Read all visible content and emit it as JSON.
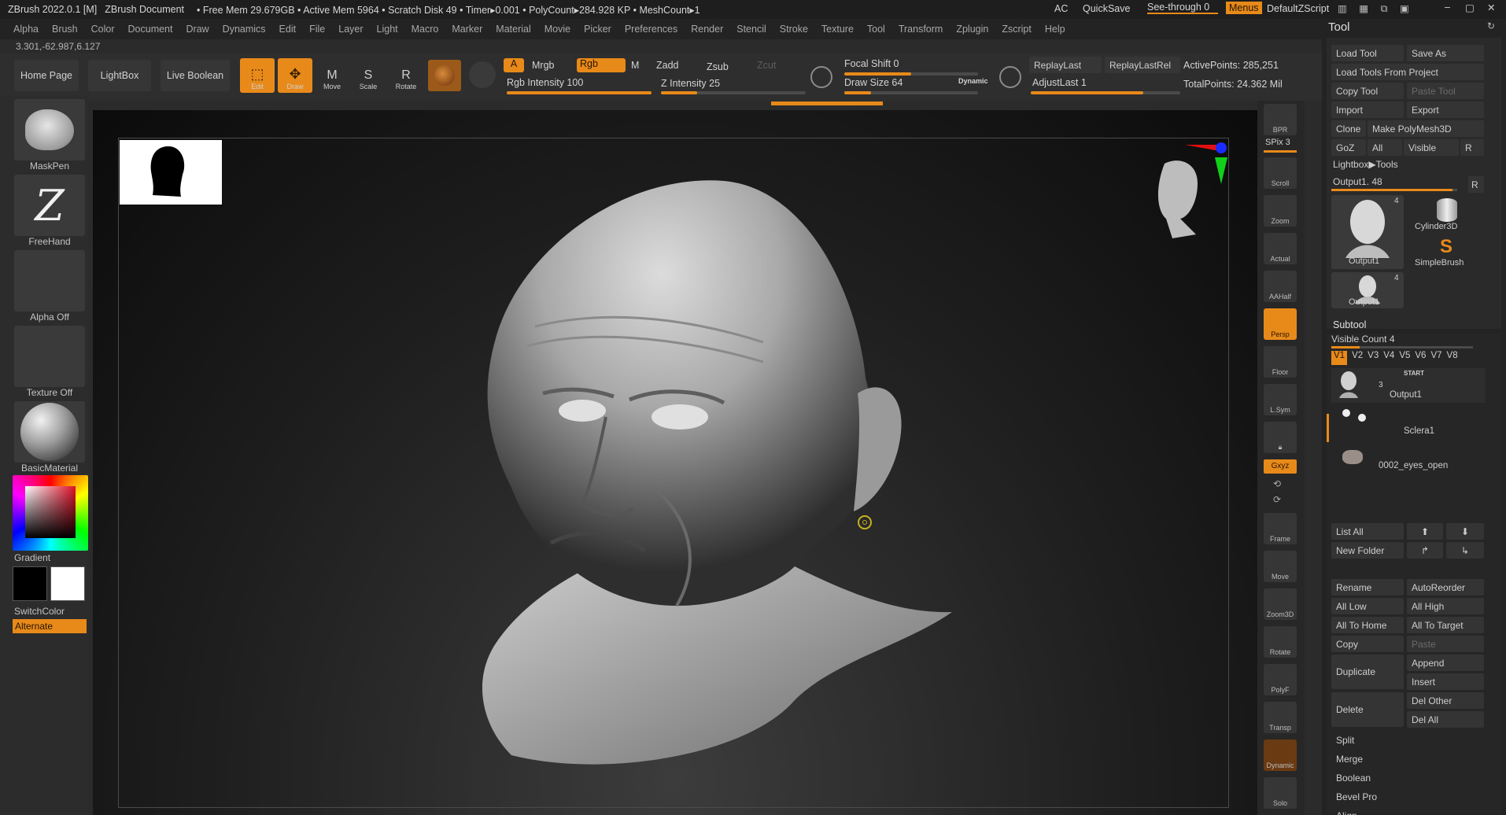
{
  "titlebar": {
    "app": "ZBrush 2022.0.1 [M]",
    "doc": "ZBrush Document",
    "stats": "• Free Mem 29.679GB • Active Mem 5964 • Scratch Disk 49 • Timer▸0.001 • PolyCount▸284.928 KP • MeshCount▸1",
    "ac": "AC",
    "quicksave": "QuickSave",
    "seethrough": "See-through  0",
    "menus": "Menus",
    "script": "DefaultZScript"
  },
  "menubar": [
    "Alpha",
    "Brush",
    "Color",
    "Document",
    "Draw",
    "Dynamics",
    "Edit",
    "File",
    "Layer",
    "Light",
    "Macro",
    "Marker",
    "Material",
    "Movie",
    "Picker",
    "Preferences",
    "Render",
    "Stencil",
    "Stroke",
    "Texture",
    "Tool",
    "Transform",
    "Zplugin",
    "Zscript",
    "Help"
  ],
  "coords": "3.301,-62.987,6.127",
  "shelf": {
    "home": "Home Page",
    "lightbox": "LightBox",
    "liveboolean": "Live Boolean",
    "edit": "Edit",
    "draw": "Draw",
    "move": "Move",
    "scale": "Scale",
    "rotate": "Rotate",
    "a": "A",
    "mrgb": "Mrgb",
    "rgb": "Rgb",
    "m": "M",
    "rgb_intensity": "Rgb Intensity 100",
    "zadd": "Zadd",
    "zsub": "Zsub",
    "zcut": "Zcut",
    "z_intensity": "Z Intensity 25",
    "focal_shift": "Focal Shift 0",
    "draw_size": "Draw Size 64",
    "dynamic": "Dynamic",
    "replaylast": "ReplayLast",
    "replaylastrel": "ReplayLastRel",
    "adjustlast": "AdjustLast 1",
    "activepoints": "ActivePoints: 285,251",
    "totalpoints": "TotalPoints: 24.362 Mil",
    "rgb_intensity_level": 1.0,
    "z_intensity_level": 0.25,
    "draw_size_level": 0.2
  },
  "left": {
    "maskpen": "MaskPen",
    "freehand": "FreeHand",
    "alphaoff": "Alpha Off",
    "textureoff": "Texture Off",
    "basicmaterial": "BasicMaterial",
    "gradient": "Gradient",
    "switchcolor": "SwitchColor",
    "alternate": "Alternate"
  },
  "right": {
    "bpr": "BPR",
    "spix": "SPix 3",
    "scroll": "Scroll",
    "zoom": "Zoom",
    "actual": "Actual",
    "aahalf": "AAHalf",
    "persp": "Persp",
    "floor": "Floor",
    "lsym": "L.Sym",
    "xyz": "Gxyz",
    "frame": "Frame",
    "move": "Move",
    "zoom3d": "Zoom3D",
    "rotate": "Rotate",
    "linefill": "Line Fill",
    "polyf": "PolyF",
    "transp": "Transp",
    "dynamic": "Dynamic",
    "solo": "Solo"
  },
  "tool": {
    "title": "Tool",
    "load": "Load Tool",
    "saveas": "Save As",
    "loadproject": "Load Tools From Project",
    "copytool": "Copy Tool",
    "pastetool": "Paste Tool",
    "import": "Import",
    "export": "Export",
    "clone": "Clone",
    "makepoly": "Make PolyMesh3D",
    "goz": "GoZ",
    "all": "All",
    "visible": "Visible",
    "r": "R",
    "lightboxtools": "Lightbox▶Tools",
    "output": "Output1. 48",
    "thumb_count": "4",
    "thumb1": "Output1",
    "thumb2": "Cylinder3D",
    "thumb3": "SimpleBrush",
    "thumb4": "Output1",
    "subtool": "Subtool",
    "visiblecount": "Visible Count 4",
    "vtabs": [
      "V1",
      "V2",
      "V3",
      "V4",
      "V5",
      "V6",
      "V7",
      "V8"
    ],
    "items": [
      "Output1",
      "Sclera1",
      "0002_eyes_open"
    ],
    "item_start": "START",
    "item_count": "3",
    "listall": "List All",
    "newfolder": "New Folder",
    "rename": "Rename",
    "autoreorder": "AutoReorder",
    "alllow": "All Low",
    "allhigh": "All High",
    "alltohome": "All To Home",
    "alltotarget": "All To Target",
    "copy": "Copy",
    "paste": "Paste",
    "duplicate": "Duplicate",
    "append": "Append",
    "insert": "Insert",
    "delete": "Delete",
    "delother": "Del Other",
    "delall": "Del All",
    "split": "Split",
    "merge": "Merge",
    "boolean": "Boolean",
    "bevelpro": "Bevel Pro",
    "align": "Align"
  },
  "colors": {
    "accent": "#e88a1a",
    "panel": "#232323",
    "viewport_dark": "#0b0b0b"
  }
}
